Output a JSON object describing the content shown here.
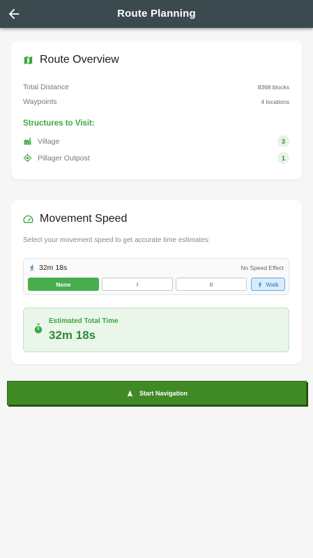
{
  "appbar": {
    "title": "Route Planning",
    "back_icon": "arrow-left-icon"
  },
  "overview": {
    "title": "Route Overview",
    "icon": "map-icon",
    "rows": [
      {
        "label": "Total Distance",
        "value": "8368 blocks"
      },
      {
        "label": "Waypoints",
        "value": "4 locations"
      }
    ],
    "structures_label": "Structures to Visit:",
    "structures": [
      {
        "name": "Village",
        "count": "3",
        "icon": "village-icon"
      },
      {
        "name": "Pillager Outpost",
        "count": "1",
        "icon": "target-icon"
      }
    ]
  },
  "speed": {
    "title": "Movement Speed",
    "icon": "speedometer-icon",
    "hint": "Select your movement speed to get accurate time estimates:",
    "current_time": "32m 18s",
    "effect": "No Speed Effect",
    "options": {
      "none": "None",
      "one": "I",
      "two": "II",
      "walk": "Walk"
    },
    "selected": "None",
    "estimate_label": "Estimated Total Time",
    "estimate_value": "32m 18s"
  },
  "action": {
    "start_label": "Start Navigation",
    "icon": "navigation-arrow-icon"
  },
  "colors": {
    "accent": "#3aa83f",
    "appbar": "#3a4a4f",
    "button": "#3f8a25",
    "walk": "#2e78c0"
  }
}
